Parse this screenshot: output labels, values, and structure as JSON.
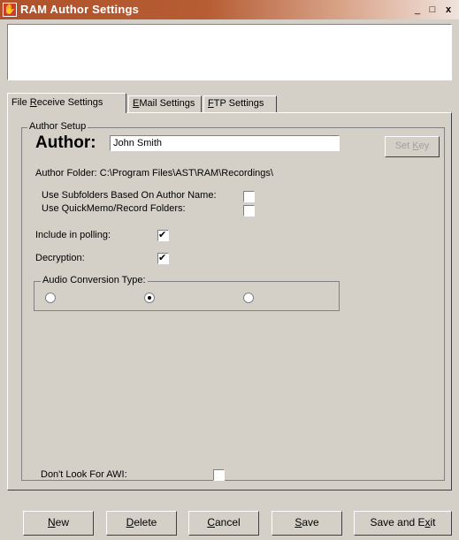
{
  "window": {
    "title": "RAM Author Settings",
    "icon": "app-hand-icon",
    "min_label": "_",
    "max_label": "□",
    "close_label": "x"
  },
  "tabs": [
    {
      "pre": "File ",
      "key": "R",
      "post": "eceive Settings"
    },
    {
      "pre": "",
      "key": "E",
      "post": "Mail Settings"
    },
    {
      "pre": "",
      "key": "F",
      "post": "TP Settings"
    }
  ],
  "author_setup": {
    "group_label": "Author Setup",
    "author_label": "Author:",
    "author_value": "John Smith",
    "set_key": {
      "pre": "Set ",
      "key": "K",
      "post": "ey"
    },
    "folder_text": "Author Folder: C:\\Program Files\\AST\\RAM\\Recordings\\",
    "use_subfolders_label": "Use Subfolders Based On Author Name:",
    "use_subfolders_checked": false,
    "use_quickmemo_label": "Use QuickMemo/Record Folders:",
    "use_quickmemo_checked": false,
    "include_polling_label": "Include in polling:",
    "include_polling_checked": true,
    "decryption_label": "Decryption:",
    "decryption_checked": true,
    "audio_conversion_label": "Audio Conversion Type:",
    "audio_selected_index": 1,
    "dont_look_label": "Don't Look For AWI:",
    "dont_look_checked": false
  },
  "buttons": [
    {
      "pre": "",
      "key": "N",
      "post": "ew"
    },
    {
      "pre": "",
      "key": "D",
      "post": "elete"
    },
    {
      "pre": "",
      "key": "C",
      "post": "ancel"
    },
    {
      "pre": "",
      "key": "S",
      "post": "ave"
    },
    {
      "pre": "Save and E",
      "key": "x",
      "post": "it"
    }
  ]
}
